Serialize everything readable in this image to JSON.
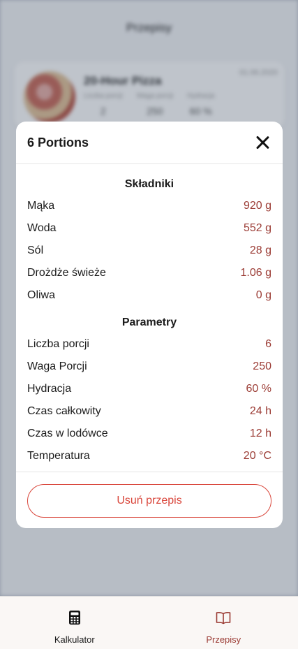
{
  "background": {
    "page_title": "Przepisy",
    "card": {
      "title": "20-Hour Pizza",
      "date": "01.06.2020",
      "meta": [
        {
          "label": "Liczba porcji",
          "value": "2"
        },
        {
          "label": "Waga porcji",
          "value": "250"
        },
        {
          "label": "Hydracja",
          "value": "60 %"
        }
      ]
    }
  },
  "modal": {
    "title": "6 Portions",
    "ingredients_title": "Składniki",
    "ingredients": [
      {
        "label": "Mąka",
        "value": "920 g"
      },
      {
        "label": "Woda",
        "value": "552 g"
      },
      {
        "label": "Sól",
        "value": "28 g"
      },
      {
        "label": "Drożdże świeże",
        "value": "1.06 g"
      },
      {
        "label": "Oliwa",
        "value": "0 g"
      }
    ],
    "parameters_title": "Parametry",
    "parameters": [
      {
        "label": "Liczba porcji",
        "value": "6"
      },
      {
        "label": "Waga Porcji",
        "value": "250"
      },
      {
        "label": "Hydracja",
        "value": "60 %"
      },
      {
        "label": "Czas całkowity",
        "value": "24 h"
      },
      {
        "label": "Czas w lodówce",
        "value": "12 h"
      },
      {
        "label": "Temperatura",
        "value": "20 °C"
      }
    ],
    "delete_label": "Usuń przepis"
  },
  "tabbar": {
    "tabs": [
      {
        "label": "Kalkulator",
        "icon": "calculator-icon",
        "active": true
      },
      {
        "label": "Przepisy",
        "icon": "book-icon",
        "active": false
      }
    ]
  },
  "colors": {
    "accent": "#9b3b34",
    "danger": "#d9463b",
    "overlay": "#2c3a52"
  }
}
